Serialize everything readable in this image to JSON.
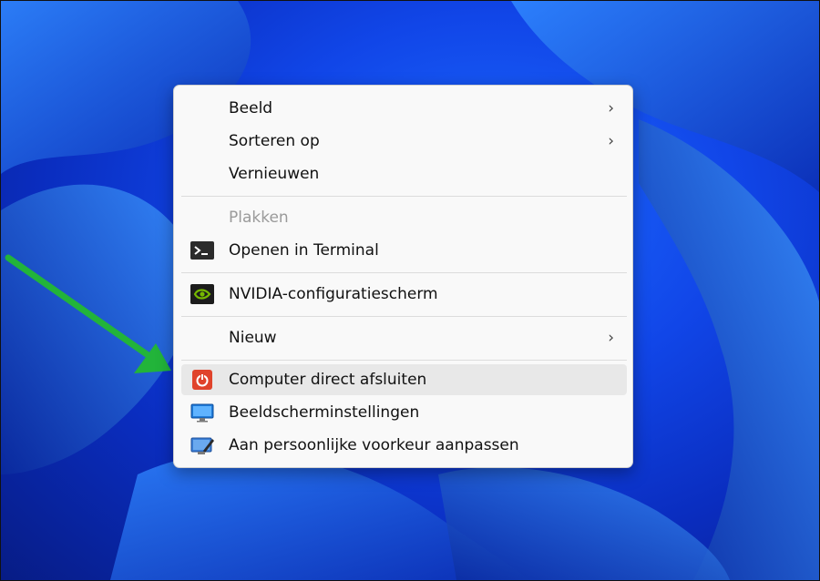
{
  "context_menu": {
    "items": [
      {
        "label": "Beeld",
        "submenu": true
      },
      {
        "label": "Sorteren op",
        "submenu": true
      },
      {
        "label": "Vernieuwen"
      },
      {
        "label": "Plakken",
        "disabled": true
      },
      {
        "label": "Openen in Terminal",
        "icon": "terminal-icon"
      },
      {
        "label": "NVIDIA-configuratiescherm",
        "icon": "nvidia-icon"
      },
      {
        "label": "Nieuw",
        "submenu": true
      },
      {
        "label": "Computer direct afsluiten",
        "icon": "power-icon",
        "highlighted": true
      },
      {
        "label": "Beeldscherminstellingen",
        "icon": "display-icon"
      },
      {
        "label": "Aan persoonlijke voorkeur aanpassen",
        "icon": "personalize-icon"
      }
    ],
    "chevron": "›"
  },
  "annotation": {
    "arrow_color": "#22b43a"
  },
  "colors": {
    "highlight": "#e8e8e8",
    "menu_bg": "#f9f9f9",
    "power_red": "#e0432b"
  }
}
